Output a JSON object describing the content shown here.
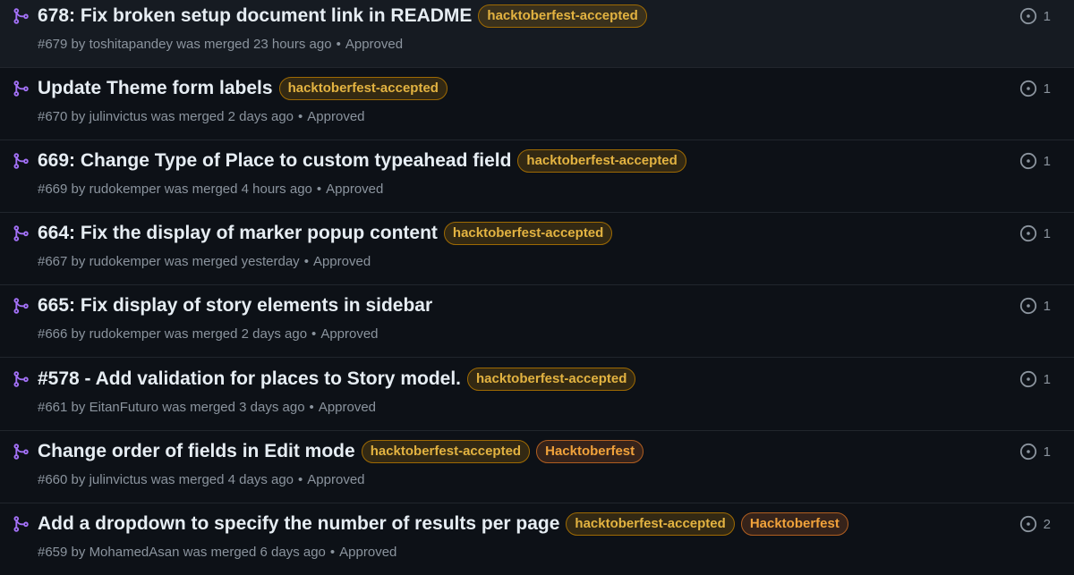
{
  "colors": {
    "background": "#0d1117",
    "merged_icon": "#a371f7",
    "label_text": "#e3b341",
    "muted_text": "#8b949e"
  },
  "pull_requests": [
    {
      "title": "678: Fix broken setup document link in README",
      "labels": [
        "hacktoberfest-accepted"
      ],
      "number": "#679",
      "by": "by",
      "author": "toshitapandey",
      "merged_text": "was merged 23 hours ago",
      "separator": "•",
      "review": "Approved",
      "comment_count": "1",
      "icon": "git-merge-icon"
    },
    {
      "title": "Update Theme form labels",
      "labels": [
        "hacktoberfest-accepted"
      ],
      "number": "#670",
      "by": "by",
      "author": "julinvictus",
      "merged_text": "was merged 2 days ago",
      "separator": "•",
      "review": "Approved",
      "comment_count": "1",
      "icon": "git-merge-icon"
    },
    {
      "title": "669: Change Type of Place to custom typeahead field",
      "labels": [
        "hacktoberfest-accepted"
      ],
      "number": "#669",
      "by": "by",
      "author": "rudokemper",
      "merged_text": "was merged 4 hours ago",
      "separator": "•",
      "review": "Approved",
      "comment_count": "1",
      "icon": "git-merge-icon"
    },
    {
      "title": "664: Fix the display of marker popup content",
      "labels": [
        "hacktoberfest-accepted"
      ],
      "number": "#667",
      "by": "by",
      "author": "rudokemper",
      "merged_text": "was merged yesterday",
      "separator": "•",
      "review": "Approved",
      "comment_count": "1",
      "icon": "git-merge-icon"
    },
    {
      "title": "665: Fix display of story elements in sidebar",
      "labels": [],
      "number": "#666",
      "by": "by",
      "author": "rudokemper",
      "merged_text": "was merged 2 days ago",
      "separator": "•",
      "review": "Approved",
      "comment_count": "1",
      "icon": "git-merge-icon"
    },
    {
      "title": "#578 - Add validation for places to Story model.",
      "labels": [
        "hacktoberfest-accepted"
      ],
      "number": "#661",
      "by": "by",
      "author": "EitanFuturo",
      "merged_text": "was merged 3 days ago",
      "separator": "•",
      "review": "Approved",
      "comment_count": "1",
      "icon": "git-merge-icon"
    },
    {
      "title": "Change order of fields in Edit mode",
      "labels": [
        "hacktoberfest-accepted",
        "Hacktoberfest"
      ],
      "number": "#660",
      "by": "by",
      "author": "julinvictus",
      "merged_text": "was merged 4 days ago",
      "separator": "•",
      "review": "Approved",
      "comment_count": "1",
      "icon": "git-merge-icon"
    },
    {
      "title": "Add a dropdown to specify the number of results per page",
      "labels": [
        "hacktoberfest-accepted",
        "Hacktoberfest"
      ],
      "number": "#659",
      "by": "by",
      "author": "MohamedAsan",
      "merged_text": "was merged 6 days ago",
      "separator": "•",
      "review": "Approved",
      "comment_count": "2",
      "icon": "git-merge-icon"
    }
  ]
}
